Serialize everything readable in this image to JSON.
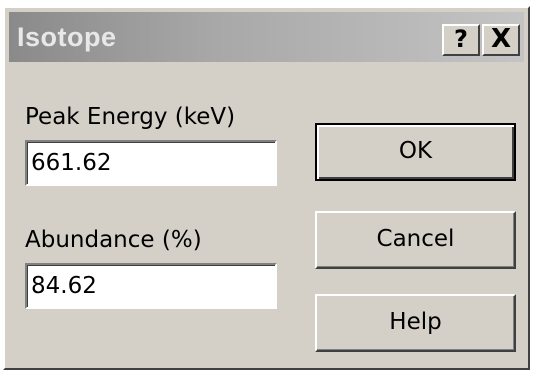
{
  "dialog": {
    "title": "Isotope",
    "help_glyph": "?",
    "close_glyph": "X"
  },
  "fields": {
    "peak_energy": {
      "label": "Peak Energy (keV)",
      "value": "661.62"
    },
    "abundance": {
      "label": "Abundance (%)",
      "value": "84.62"
    }
  },
  "buttons": {
    "ok": "OK",
    "cancel": "Cancel",
    "help": "Help"
  }
}
